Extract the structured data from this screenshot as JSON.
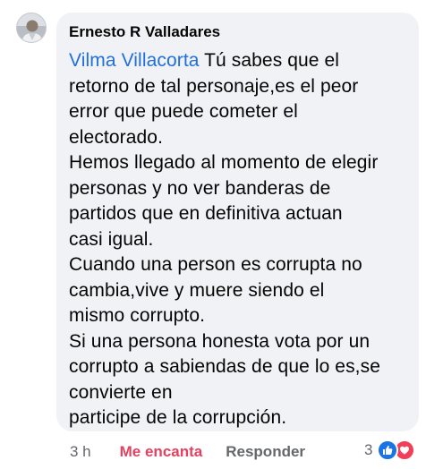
{
  "comment": {
    "author": "Ernesto R Valladares",
    "mention": "Vilma Villacorta",
    "lines": [
      " Tú sabes que el",
      "retorno de tal personaje,es el peor",
      "error que puede cometer el",
      "electorado.",
      "Hemos llegado al momento de elegir",
      "personas y no ver banderas de",
      "partidos que en definitiva actuan",
      "casi igual.",
      "Cuando una person es corrupta no",
      "cambia,vive y muere siendo el",
      "mismo corrupto.",
      "Si una persona honesta vota por un",
      "corrupto a sabiendas de que lo es,se",
      "convierte en",
      "participe de la corrupción."
    ]
  },
  "actions": {
    "time": "3 h",
    "react_label": "Me encanta",
    "reply_label": "Responder"
  },
  "reactions": {
    "count": "3",
    "icons": [
      "like-icon",
      "love-icon"
    ]
  },
  "colors": {
    "bubble": "#f0f2f5",
    "mention": "#216fdb",
    "love": "#e4405f",
    "like": "#1b74e4",
    "secondary_text": "#65676b"
  }
}
